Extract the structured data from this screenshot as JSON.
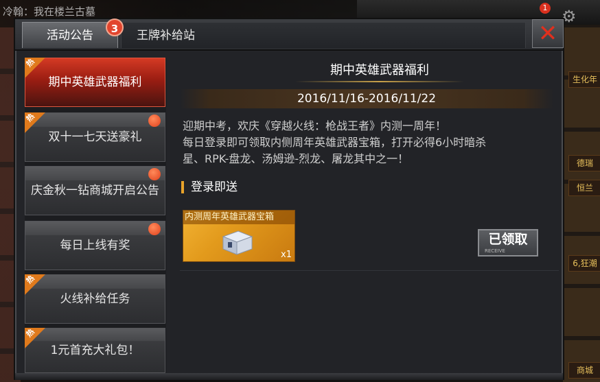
{
  "background": {
    "chat_text": "冷翰：我在楼兰古墓",
    "right_tags": [
      "生化年",
      "德瑞",
      "恒兰",
      "6,狂潮",
      "商城"
    ]
  },
  "top_bar": {
    "notification_count": "1"
  },
  "tabs": [
    {
      "label": "活动公告",
      "active": true,
      "badge": "3"
    },
    {
      "label": "王牌补给站",
      "active": false
    }
  ],
  "sidebar": {
    "items": [
      {
        "label": "期中英雄武器福利",
        "hot": true,
        "dot": false,
        "active": true
      },
      {
        "label": "双十一七天送豪礼",
        "hot": true,
        "dot": true,
        "active": false
      },
      {
        "label": "庆金秋一钻商城开启公告",
        "hot": false,
        "dot": true,
        "active": false
      },
      {
        "label": "每日上线有奖",
        "hot": false,
        "dot": true,
        "active": false
      },
      {
        "label": "火线补给任务",
        "hot": true,
        "dot": false,
        "active": false
      },
      {
        "label": "1元首充大礼包！",
        "hot": true,
        "dot": false,
        "active": false
      }
    ],
    "hot_text": "热"
  },
  "event": {
    "title": "期中英雄武器福利",
    "date_range": "2016/11/16-2016/11/22",
    "desc_line1": "迎期中考，欢庆《穿越火线：枪战王者》内测一周年！",
    "desc_line2": "每日登录即可领取内侧周年英雄武器宝箱，打开必得6小时暗杀",
    "desc_line3": "星、RPK-盘龙、汤姆逊-烈龙、屠龙其中之一！",
    "section_label": "登录即送",
    "reward": {
      "name": "内测周年英雄武器宝箱",
      "quantity": "x1"
    },
    "claim_button": "已领取",
    "claim_sub": "RECEIVE"
  },
  "colors": {
    "accent_red": "#d43a24",
    "hot_orange": "#e07a1c",
    "gold": "#e8a32a",
    "close_red": "#e0301e"
  }
}
